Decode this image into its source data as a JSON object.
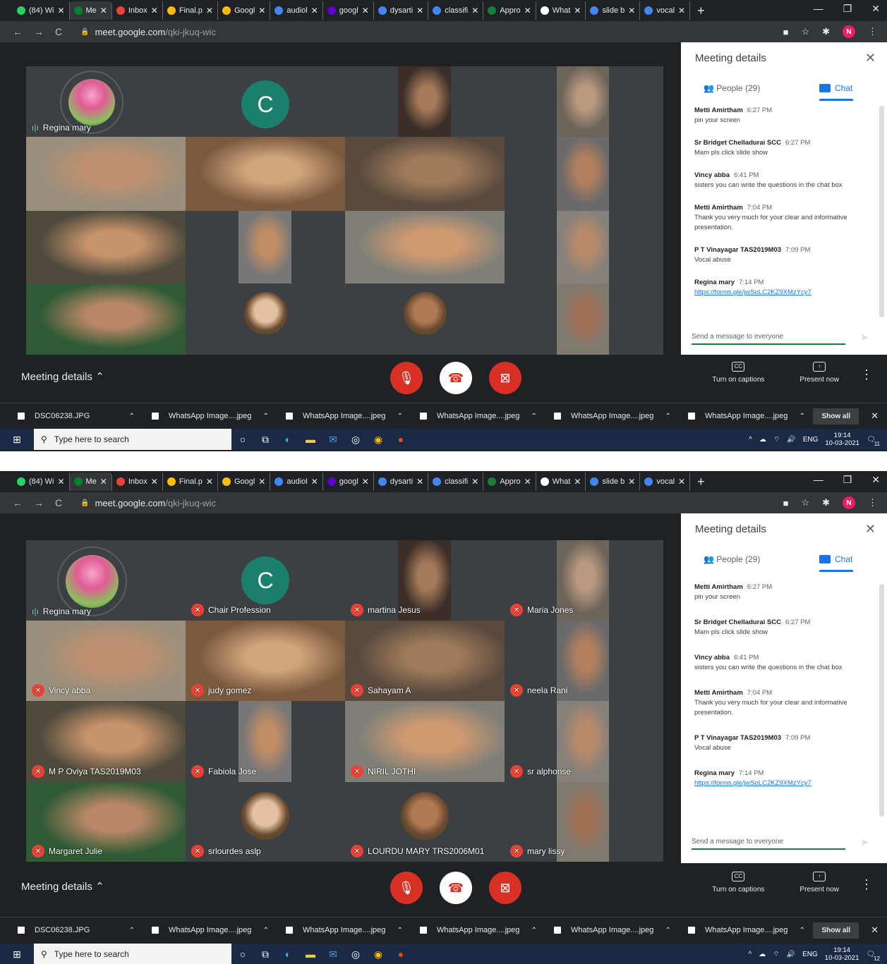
{
  "browser": {
    "tabs": [
      "(84) Wi",
      "Me",
      "Inbox",
      "Final.p",
      "Googl",
      "audiol",
      "googl",
      "dysarti",
      "classifi",
      "Appro",
      "What",
      "slide b",
      "vocal"
    ],
    "url_host": "meet.google.com",
    "url_path": "/qki-jkuq-wic",
    "profile_initial": "N"
  },
  "meet": {
    "participants": [
      "Regina mary",
      "Chair Profession",
      "martina Jesus",
      "Maria Jones",
      "Vincy abba",
      "judy gomez",
      "Sahayam A",
      "neela Rani",
      "M P Oviya TAS2019M03",
      "Fabiola Jose",
      "NIRIL JOTHI",
      "sr alphonse",
      "Margaret Julie",
      "srlourdes aslp",
      "LOURDU MARY TRS2006M01",
      "mary lissy"
    ],
    "avatar_letter": "C",
    "meeting_details_label": "Meeting details",
    "captions_label": "Turn on captions",
    "present_label": "Present now"
  },
  "panel": {
    "title": "Meeting details",
    "people_tab": "People (29)",
    "chat_tab": "Chat",
    "messages": [
      {
        "who": "Metti Amirtham",
        "time": "6:27 PM",
        "text": "pin your screen"
      },
      {
        "who": "Sr Bridget Chelladurai SCC",
        "time": "6:27 PM",
        "text": "Mam pls click slide show"
      },
      {
        "who": "Vincy abba",
        "time": "6:41 PM",
        "text": "sisters you can write the  questions in the chat box"
      },
      {
        "who": "Metti Amirtham",
        "time": "7:04 PM",
        "text": "Thank you very much for your clear and informative presentation."
      },
      {
        "who": "P T Vinayagar TAS2019M03",
        "time": "7:09 PM",
        "text": "Vocal abuse"
      },
      {
        "who": "Regina mary",
        "time": "7:14 PM",
        "link": "https://forms.gle/jwSoLC2KZ9XMzYcy7"
      }
    ],
    "send_placeholder": "Send a message to everyone"
  },
  "downloads": {
    "files": [
      "DSC06238.JPG",
      "WhatsApp Image....jpeg",
      "WhatsApp Image....jpeg",
      "WhatsApp Image....jpeg",
      "WhatsApp Image....jpeg",
      "WhatsApp Image....jpeg"
    ],
    "show_all": "Show all"
  },
  "taskbar": {
    "search_placeholder": "Type here to search",
    "lang": "ENG",
    "time": "19:14",
    "date": "10-03-2021",
    "notif_1": "11",
    "notif_2": "12"
  },
  "colors": {
    "meet_bg": "#202124",
    "tile_bg": "#3c4043",
    "end_call_red": "#d93025",
    "chat_blue": "#1a73e8",
    "avatar_teal": "#1a7f6b"
  }
}
